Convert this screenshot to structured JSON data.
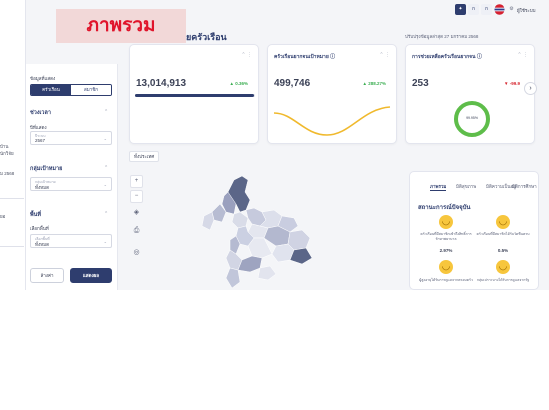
{
  "header": {
    "overlay_title": "ภาพรวม",
    "page_title_suffix": "ยครัวเรือน",
    "update_text": "ปรับปรุงข้อมูลล่าสุด 27 มกราคม 2568",
    "user_label": "ผู้ใช้ระบบ"
  },
  "edge": {
    "text_1": "บ้าน",
    "text_2": "นักวิจัย",
    "text_3": "ม 2568",
    "text_4": "ยอ"
  },
  "sidebar": {
    "data_type_label": "ข้อมูลที่แสดง",
    "seg_household": "ครัวเรือน",
    "seg_member": "สมาชิก",
    "section_time": "ช่วงเวลา",
    "year_label": "ปีที่แสดง",
    "year_small": "ปีระบบ",
    "year_value": "2567",
    "section_target": "กลุ่มเป้าหมาย",
    "target_small": "กลุ่มเป้าหมาย",
    "target_value": "ทั้งหมด",
    "section_area": "พื้นที่",
    "area_label": "เลือกพื้นที่",
    "area_small": "เลือกพื้นที่",
    "area_value": "ทั้งหมด",
    "reset_label": "ล้างค่า",
    "search_label": "แสดงผล"
  },
  "kpis": [
    {
      "title": "",
      "value": "13,014,913",
      "change": "0.36%",
      "direction": "up"
    },
    {
      "title": "ครัวเรือนยากจนเป้าหมาย ⓘ",
      "value": "499,746",
      "change": "288.27%",
      "direction": "up"
    },
    {
      "title": "การช่วยเหลือครัวเรือนยากจน ⓘ",
      "value": "253",
      "change": "-99.9",
      "direction": "down",
      "gauge_label": "99.95%"
    }
  ],
  "map": {
    "tag": "ทั้งประเทศ",
    "zoom_in": "+",
    "zoom_out": "−"
  },
  "panel": {
    "tabs": [
      "ภาพรวม",
      "มิติสุขภาพ",
      "มิติความเป็นอยู่",
      "มิติการศึกษา",
      "มิติรายได้"
    ],
    "title": "สถานะการณ์ปัจจุบัน",
    "stats": [
      {
        "desc": "ครัวเรือนที่มีสมาชิกเข้าถึงสิทธิ์การรักษาพยาบาล",
        "value": "2.97%"
      },
      {
        "desc": "ครัวเรือนที่มีสมาชิกได้รับวัคซีนครบ",
        "value": "0.5%"
      },
      {
        "desc": "ผู้สูงอายุได้รับการดูแลจากครอบครัว",
        "value": ""
      },
      {
        "desc": "กลุ่มเปราะบางได้รับการดูแลจากรัฐ",
        "value": ""
      }
    ]
  },
  "colors": {
    "navy": "#2e3d6e",
    "up": "#3cae52",
    "down": "#d6262f",
    "gauge": "#5ebd4a",
    "overlay_bg": "#f2d8d8",
    "overlay_text": "#e0142b"
  }
}
